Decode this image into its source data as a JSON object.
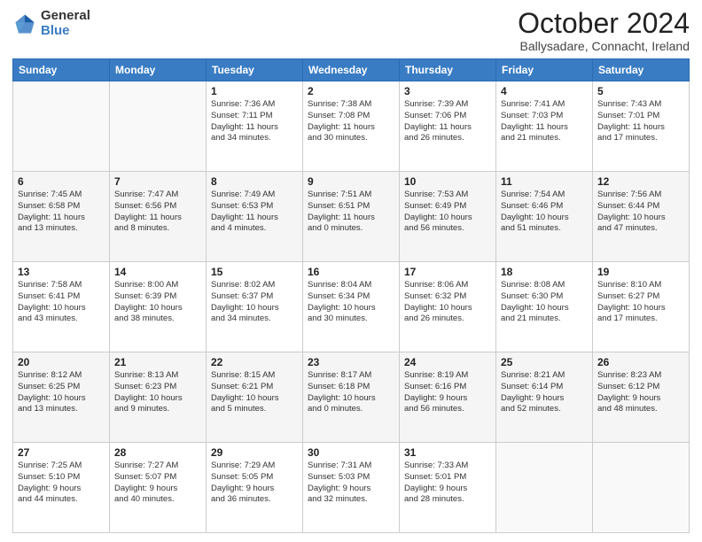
{
  "header": {
    "logo_general": "General",
    "logo_blue": "Blue",
    "month_title": "October 2024",
    "location": "Ballysadare, Connacht, Ireland"
  },
  "days_of_week": [
    "Sunday",
    "Monday",
    "Tuesday",
    "Wednesday",
    "Thursday",
    "Friday",
    "Saturday"
  ],
  "weeks": [
    [
      {
        "day": "",
        "info": ""
      },
      {
        "day": "",
        "info": ""
      },
      {
        "day": "1",
        "info": "Sunrise: 7:36 AM\nSunset: 7:11 PM\nDaylight: 11 hours\nand 34 minutes."
      },
      {
        "day": "2",
        "info": "Sunrise: 7:38 AM\nSunset: 7:08 PM\nDaylight: 11 hours\nand 30 minutes."
      },
      {
        "day": "3",
        "info": "Sunrise: 7:39 AM\nSunset: 7:06 PM\nDaylight: 11 hours\nand 26 minutes."
      },
      {
        "day": "4",
        "info": "Sunrise: 7:41 AM\nSunset: 7:03 PM\nDaylight: 11 hours\nand 21 minutes."
      },
      {
        "day": "5",
        "info": "Sunrise: 7:43 AM\nSunset: 7:01 PM\nDaylight: 11 hours\nand 17 minutes."
      }
    ],
    [
      {
        "day": "6",
        "info": "Sunrise: 7:45 AM\nSunset: 6:58 PM\nDaylight: 11 hours\nand 13 minutes."
      },
      {
        "day": "7",
        "info": "Sunrise: 7:47 AM\nSunset: 6:56 PM\nDaylight: 11 hours\nand 8 minutes."
      },
      {
        "day": "8",
        "info": "Sunrise: 7:49 AM\nSunset: 6:53 PM\nDaylight: 11 hours\nand 4 minutes."
      },
      {
        "day": "9",
        "info": "Sunrise: 7:51 AM\nSunset: 6:51 PM\nDaylight: 11 hours\nand 0 minutes."
      },
      {
        "day": "10",
        "info": "Sunrise: 7:53 AM\nSunset: 6:49 PM\nDaylight: 10 hours\nand 56 minutes."
      },
      {
        "day": "11",
        "info": "Sunrise: 7:54 AM\nSunset: 6:46 PM\nDaylight: 10 hours\nand 51 minutes."
      },
      {
        "day": "12",
        "info": "Sunrise: 7:56 AM\nSunset: 6:44 PM\nDaylight: 10 hours\nand 47 minutes."
      }
    ],
    [
      {
        "day": "13",
        "info": "Sunrise: 7:58 AM\nSunset: 6:41 PM\nDaylight: 10 hours\nand 43 minutes."
      },
      {
        "day": "14",
        "info": "Sunrise: 8:00 AM\nSunset: 6:39 PM\nDaylight: 10 hours\nand 38 minutes."
      },
      {
        "day": "15",
        "info": "Sunrise: 8:02 AM\nSunset: 6:37 PM\nDaylight: 10 hours\nand 34 minutes."
      },
      {
        "day": "16",
        "info": "Sunrise: 8:04 AM\nSunset: 6:34 PM\nDaylight: 10 hours\nand 30 minutes."
      },
      {
        "day": "17",
        "info": "Sunrise: 8:06 AM\nSunset: 6:32 PM\nDaylight: 10 hours\nand 26 minutes."
      },
      {
        "day": "18",
        "info": "Sunrise: 8:08 AM\nSunset: 6:30 PM\nDaylight: 10 hours\nand 21 minutes."
      },
      {
        "day": "19",
        "info": "Sunrise: 8:10 AM\nSunset: 6:27 PM\nDaylight: 10 hours\nand 17 minutes."
      }
    ],
    [
      {
        "day": "20",
        "info": "Sunrise: 8:12 AM\nSunset: 6:25 PM\nDaylight: 10 hours\nand 13 minutes."
      },
      {
        "day": "21",
        "info": "Sunrise: 8:13 AM\nSunset: 6:23 PM\nDaylight: 10 hours\nand 9 minutes."
      },
      {
        "day": "22",
        "info": "Sunrise: 8:15 AM\nSunset: 6:21 PM\nDaylight: 10 hours\nand 5 minutes."
      },
      {
        "day": "23",
        "info": "Sunrise: 8:17 AM\nSunset: 6:18 PM\nDaylight: 10 hours\nand 0 minutes."
      },
      {
        "day": "24",
        "info": "Sunrise: 8:19 AM\nSunset: 6:16 PM\nDaylight: 9 hours\nand 56 minutes."
      },
      {
        "day": "25",
        "info": "Sunrise: 8:21 AM\nSunset: 6:14 PM\nDaylight: 9 hours\nand 52 minutes."
      },
      {
        "day": "26",
        "info": "Sunrise: 8:23 AM\nSunset: 6:12 PM\nDaylight: 9 hours\nand 48 minutes."
      }
    ],
    [
      {
        "day": "27",
        "info": "Sunrise: 7:25 AM\nSunset: 5:10 PM\nDaylight: 9 hours\nand 44 minutes."
      },
      {
        "day": "28",
        "info": "Sunrise: 7:27 AM\nSunset: 5:07 PM\nDaylight: 9 hours\nand 40 minutes."
      },
      {
        "day": "29",
        "info": "Sunrise: 7:29 AM\nSunset: 5:05 PM\nDaylight: 9 hours\nand 36 minutes."
      },
      {
        "day": "30",
        "info": "Sunrise: 7:31 AM\nSunset: 5:03 PM\nDaylight: 9 hours\nand 32 minutes."
      },
      {
        "day": "31",
        "info": "Sunrise: 7:33 AM\nSunset: 5:01 PM\nDaylight: 9 hours\nand 28 minutes."
      },
      {
        "day": "",
        "info": ""
      },
      {
        "day": "",
        "info": ""
      }
    ]
  ]
}
